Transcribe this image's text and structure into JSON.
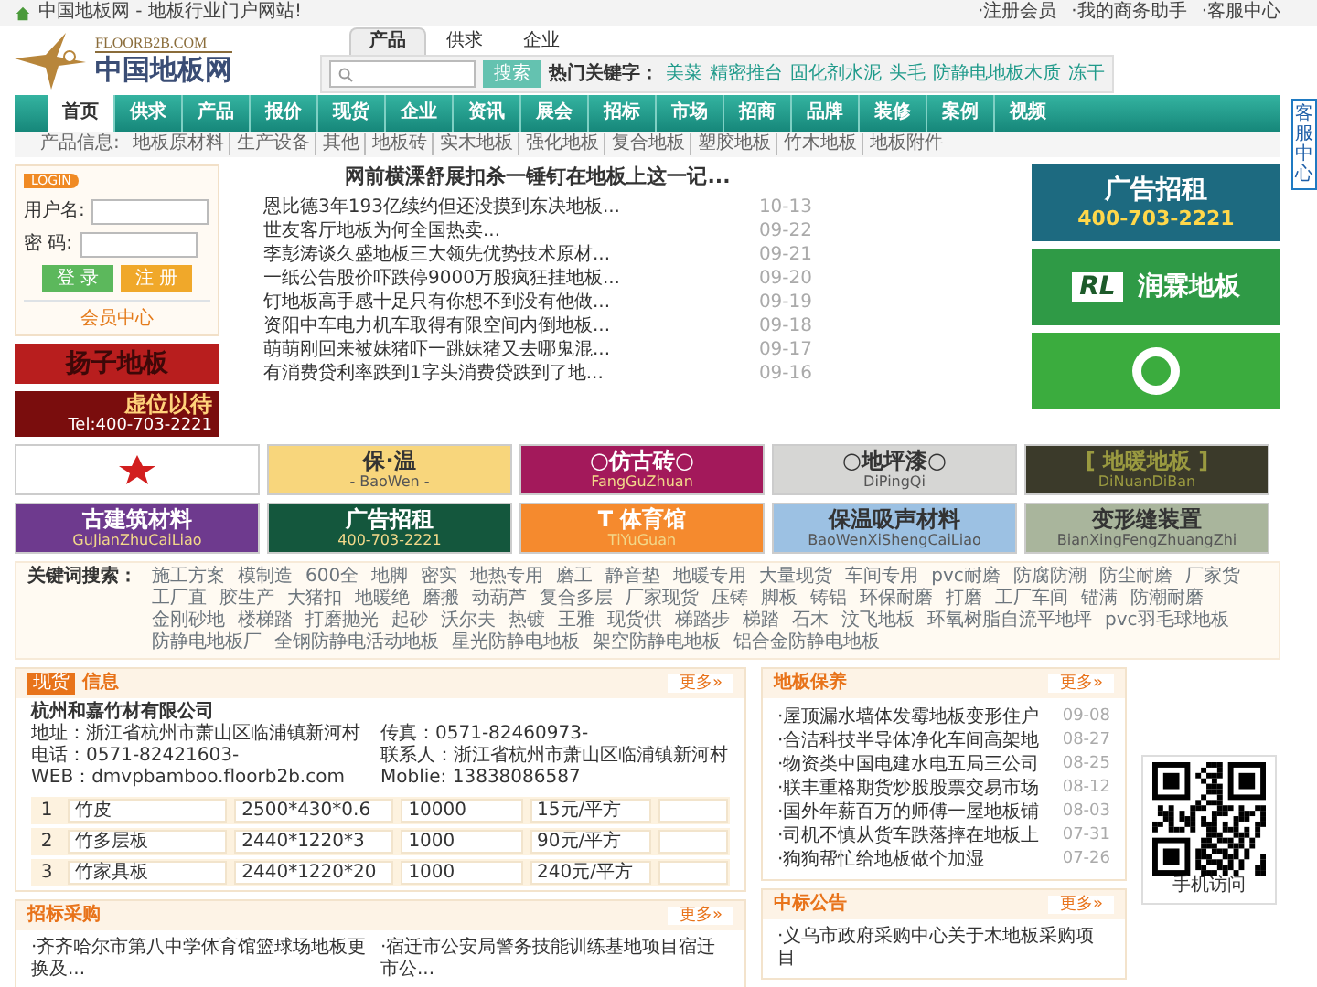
{
  "top_bar": {
    "site_title": "中国地板网 - 地板行业门户网站!",
    "links": [
      "·注册会员",
      "·我的商务助手",
      "·客服中心"
    ]
  },
  "logo": {
    "domain": "FLOORB2B.COM",
    "name": "中国地板网"
  },
  "search": {
    "tabs": [
      {
        "label": "产品",
        "selected": true
      },
      {
        "label": "供求",
        "selected": false
      },
      {
        "label": "企业",
        "selected": false
      }
    ],
    "button": "搜索",
    "hot_label": "热门关键字：",
    "hot_keywords": [
      "美菜",
      "精密推台",
      "固化剂水泥",
      "头毛",
      "防静电地板木质",
      "冻干"
    ]
  },
  "nav": [
    {
      "label": "首页",
      "selected": true
    },
    {
      "label": "供求",
      "selected": false
    },
    {
      "label": "产品",
      "selected": false
    },
    {
      "label": "报价",
      "selected": false
    },
    {
      "label": "现货",
      "selected": false
    },
    {
      "label": "企业",
      "selected": false
    },
    {
      "label": "资讯",
      "selected": false
    },
    {
      "label": "展会",
      "selected": false
    },
    {
      "label": "招标",
      "selected": false
    },
    {
      "label": "市场",
      "selected": false
    },
    {
      "label": "招商",
      "selected": false
    },
    {
      "label": "品牌",
      "selected": false
    },
    {
      "label": "装修",
      "selected": false
    },
    {
      "label": "案例",
      "selected": false
    },
    {
      "label": "视频",
      "selected": false
    }
  ],
  "subnav": {
    "label": "产品信息:",
    "items": [
      "地板原材料",
      "生产设备",
      "其他",
      "地板砖",
      "实木地板",
      "强化地板",
      "复合地板",
      "塑胶地板",
      "竹木地板",
      "地板附件"
    ]
  },
  "login": {
    "tag": "LOGIN",
    "username_label": "用户名:",
    "password_label": "密 码:",
    "login_button": "登 录",
    "register_button": "注 册",
    "member_link": "会员中心"
  },
  "left_ads": [
    {
      "title": "扬子地板"
    },
    {
      "title": "虚位以待",
      "subtitle": "Tel:400-703-2221"
    }
  ],
  "news": {
    "headline": "网前横溧舒展扣杀一锤钉在地板上这一记...",
    "items": [
      {
        "title": "恩比德3年193亿续约但还没摸到东决地板...",
        "date": "10-13"
      },
      {
        "title": "世友客厅地板为何全国热卖...",
        "date": "09-22"
      },
      {
        "title": "李彭涛谈久盛地板三大领先优势技术原材...",
        "date": "09-21"
      },
      {
        "title": "一纸公告股价吓跌停9000万股疯狂挂地板...",
        "date": "09-20"
      },
      {
        "title": "钉地板高手感十足只有你想不到没有他做...",
        "date": "09-19"
      },
      {
        "title": "资阳中车电力机车取得有限空间内倒地板...",
        "date": "09-18"
      },
      {
        "title": "萌萌刚回来被妹猪吓一跳妹猪又去哪鬼混...",
        "date": "09-17"
      },
      {
        "title": "有消费贷利率跌到1字头消费贷跌到了地...",
        "date": "09-16"
      }
    ]
  },
  "right_ads": [
    {
      "kind": "text",
      "title": "广告招租",
      "subtitle": "400-703-2221"
    },
    {
      "kind": "brand",
      "mark": "RL",
      "title": "润霖地板"
    },
    {
      "kind": "logo"
    }
  ],
  "tiles": [
    {
      "kind": "logo",
      "color": "#ffffff"
    },
    {
      "kind": "text",
      "title": "保·温",
      "subtitle": "- BaoWen -",
      "color": "#f8d67c"
    },
    {
      "kind": "text",
      "title": "○仿古砖○",
      "subtitle": "FangGuZhuan",
      "color": "#a3195b"
    },
    {
      "kind": "text",
      "title": "○地坪漆○",
      "subtitle": "DiPingQi",
      "color": "#d6d6d4"
    },
    {
      "kind": "text",
      "title": "[ 地暖地板 ]",
      "subtitle": "DiNuanDiBan",
      "color": "#3b3a2a"
    },
    {
      "kind": "text",
      "title": "古建筑材料",
      "subtitle": "GuJianZhuCaiLiao",
      "color": "#6e3a8e"
    },
    {
      "kind": "text",
      "title": "广告招租",
      "subtitle": "400-703-2221",
      "color": "#14573d"
    },
    {
      "kind": "text",
      "title": "T 体育馆",
      "subtitle": "TiYuGuan",
      "color": "#f58a2e"
    },
    {
      "kind": "text",
      "title": "保温吸声材料",
      "subtitle": "BaoWenXiShengCaiLiao",
      "color": "#9cc1e3"
    },
    {
      "kind": "text",
      "title": "变形缝装置",
      "subtitle": "BianXingFengZhuangZhi",
      "color": "#a9b59c"
    }
  ],
  "keyword_search": {
    "label": "关键词搜索：",
    "keywords": [
      "施工方案",
      "模制造",
      "600全",
      "地脚",
      "密实",
      "地热专用",
      "磨工",
      "静音垫",
      "地暖专用",
      "大量现货",
      "车间专用",
      "pvc耐磨",
      "防腐防潮",
      "防尘耐磨",
      "厂家货",
      "工厂直",
      "胶生产",
      "大猪扣",
      "地暖绝",
      "磨搬",
      "动葫芦",
      "复合多层",
      "厂家现货",
      "压铸",
      "脚板",
      "铸铝",
      "环保耐磨",
      "打磨",
      "工厂车间",
      "锚满",
      "防潮耐磨",
      "金刚砂地",
      "楼梯踏",
      "打磨抛光",
      "起砂",
      "沃尔夫",
      "热镀",
      "王雅",
      "现货供",
      "梯踏步",
      "梯踏",
      "石木",
      "汶飞地板",
      "环氧树脂自流平地坪",
      "pvc羽毛球地板",
      "防静电地板厂",
      "全钢防静电活动地板",
      "星光防静电地板",
      "架空防静电地板",
      "铝合金防静电地板"
    ]
  },
  "stock": {
    "tag": "现货",
    "title": "信息",
    "more": "更多»",
    "company": "杭州和嘉竹材有限公司",
    "fields": [
      "地址：浙江省杭州市萧山区临浦镇新河村",
      "传真：0571-82460973-",
      "电话：0571-82421603-",
      "联系人：浙江省杭州市萧山区临浦镇新河村",
      "WEB：dmvpbamboo.floorb2b.com",
      "Moblie: 13838086587"
    ],
    "rows": [
      {
        "index": "1",
        "cells": [
          "竹皮",
          "2500*430*0.6",
          "10000",
          "15元/平方"
        ]
      },
      {
        "index": "2",
        "cells": [
          "竹多层板",
          "2440*1220*3",
          "1000",
          "90元/平方"
        ]
      },
      {
        "index": "3",
        "cells": [
          "竹家具板",
          "2440*1220*20",
          "1000",
          "240元/平方"
        ]
      }
    ]
  },
  "care": {
    "title": "地板保养",
    "more": "更多»",
    "items": [
      {
        "title": "·屋顶漏水墙体发霉地板变形住户",
        "date": "09-08"
      },
      {
        "title": "·合洁科技半导体净化车间高架地",
        "date": "08-27"
      },
      {
        "title": "·物资类中国电建水电五局三公司",
        "date": "08-25"
      },
      {
        "title": "·联丰重格期货炒股股票交易市场",
        "date": "08-12"
      },
      {
        "title": "·国外年薪百万的师傅一屋地板铺",
        "date": "08-03"
      },
      {
        "title": "·司机不慎从货车跌落摔在地板上",
        "date": "07-31"
      },
      {
        "title": "·狗狗帮忙给地板做个加湿",
        "date": "07-26"
      }
    ]
  },
  "qr": {
    "caption": "手机访问"
  },
  "tenders": {
    "title": "招标采购",
    "more": "更多»",
    "items": [
      "·齐齐哈尔市第八中学体育馆篮球场地板更换及...",
      "·宿迁市公安局警务技能训练基地项目宿迁市公..."
    ]
  },
  "awards": {
    "title": "中标公告",
    "more": "更多»",
    "items": [
      "·义乌市政府采购中心关于木地板采购项目"
    ]
  },
  "float_tab": {
    "label": "客服中心"
  }
}
